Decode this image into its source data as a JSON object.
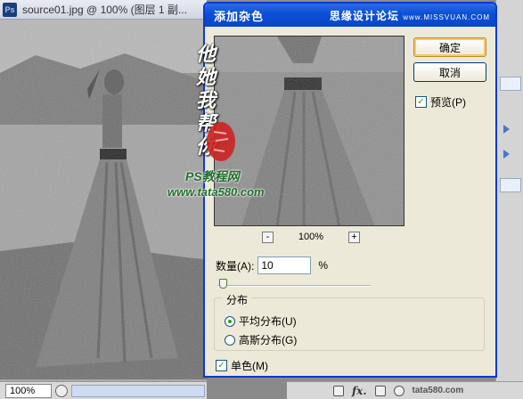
{
  "document": {
    "title": "source01.jpg @ 100% (图层 1 副...",
    "app_icon": "Ps",
    "zoom": "100%"
  },
  "dialog": {
    "title": "添加杂色",
    "watermark_main": "思缘设计论坛",
    "watermark_sub": "www.MISSVUAN.COM",
    "ok_label": "确定",
    "cancel_label": "取消",
    "preview_label": "预览(P)",
    "preview_checked": true,
    "preview_zoom": "100%",
    "zoom_minus": "-",
    "zoom_plus": "+",
    "amount_label": "数量(A):",
    "amount_value": "10",
    "amount_unit": "%",
    "distribution_label": "分布",
    "uniform_label": "平均分布(U)",
    "gaussian_label": "高斯分布(G)",
    "uniform_selected": true,
    "mono_label": "单色(M)",
    "mono_checked": true
  },
  "overlay_watermark": {
    "calligraphy": "他她我帮你",
    "seal": "",
    "brand_text": "PS教程网",
    "url_text": "www.tata580.com"
  },
  "bottom_bar": {
    "fx_label": "fx.",
    "brand_text": "tata580.com"
  },
  "colors": {
    "dialog_title_blue": "#0b4fd6",
    "dialog_body": "#ece9d8",
    "check_green": "#21a121",
    "seal_red": "#cc2222",
    "watermark_green": "#1f6f2a"
  }
}
